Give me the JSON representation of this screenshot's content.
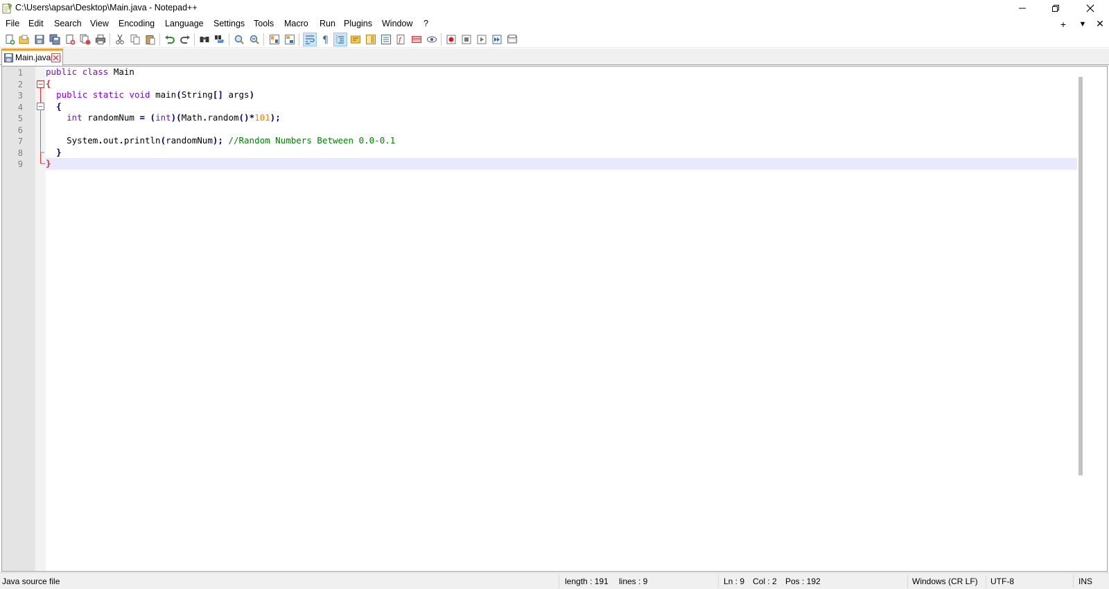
{
  "window": {
    "title": "C:\\Users\\apsar\\Desktop\\Main.java - Notepad++"
  },
  "menu": {
    "items": [
      "File",
      "Edit",
      "Search",
      "View",
      "Encoding",
      "Language",
      "Settings",
      "Tools",
      "Macro",
      "Run",
      "Plugins",
      "Window",
      "?"
    ],
    "right_controls": [
      "+",
      "▼",
      "✕"
    ]
  },
  "toolbar": {
    "icons": [
      "new-file-icon",
      "open-file-icon",
      "save-icon",
      "save-all-icon",
      "close-icon",
      "close-all-icon",
      "print-icon",
      "cut-icon",
      "copy-icon",
      "paste-icon",
      "undo-icon",
      "redo-icon",
      "find-icon",
      "replace-icon",
      "zoom-in-icon",
      "zoom-out-icon",
      "sync-vertical-icon",
      "sync-horizontal-icon",
      "word-wrap-icon",
      "show-all-chars-icon",
      "indent-guide-icon",
      "udl-icon",
      "doc-map-icon",
      "function-list-icon",
      "folder-workspace-icon",
      "monitoring-icon",
      "macro-record-icon",
      "macro-stop-icon",
      "macro-play-icon",
      "macro-run-multiple-icon",
      "macro-save-icon"
    ]
  },
  "tabs": [
    {
      "label": "Main.java",
      "active": true
    }
  ],
  "editor": {
    "line_numbers": [
      "1",
      "2",
      "3",
      "4",
      "5",
      "6",
      "7",
      "8",
      "9"
    ],
    "current_line": 9,
    "lines": [
      "public class Main",
      "{",
      "  public static void main(String[] args)",
      "  {",
      "    int randomNum = (int)(Math.random()*101);",
      "",
      "    System.out.println(randomNum); //Random Numbers Between 0.0-0.1",
      "  }",
      "}"
    ]
  },
  "status": {
    "file_type": "Java source file",
    "length": "length : 191",
    "lines": "lines : 9",
    "ln": "Ln : 9",
    "col": "Col : 2",
    "pos": "Pos : 192",
    "eol": "Windows (CR LF)",
    "encoding": "UTF-8",
    "mode": "INS"
  },
  "colors": {
    "keyword": "#8000ff",
    "number": "#ff8000",
    "operator": "#000080",
    "comment": "#008000",
    "current_line": "#e8e8ff",
    "tab_accent": "#fa9d23"
  }
}
